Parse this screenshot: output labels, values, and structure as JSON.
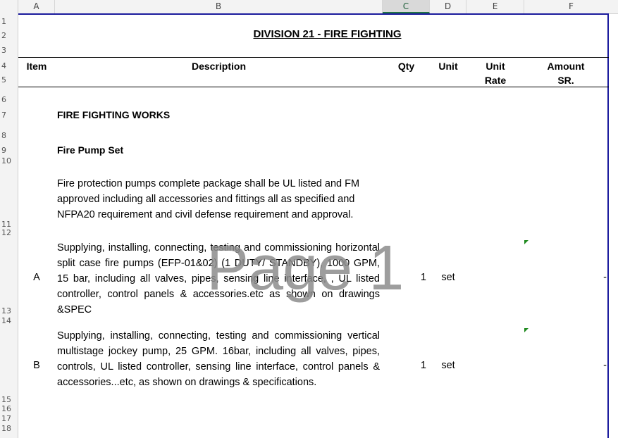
{
  "columns": [
    "A",
    "B",
    "C",
    "D",
    "E",
    "F"
  ],
  "selected_column": "C",
  "rows": [
    "1",
    "2",
    "3",
    "4",
    "5",
    "6",
    "7",
    "8",
    "9",
    "10",
    "11",
    "12",
    "13",
    "14",
    "15",
    "16",
    "17",
    "18"
  ],
  "title": "DIVISION 21 - FIRE FIGHTING",
  "header": {
    "item": "Item",
    "description": "Description",
    "qty": "Qty",
    "unit": "Unit",
    "unit_rate_line1": "Unit",
    "unit_rate_line2": "Rate",
    "amount_line1": "Amount",
    "amount_line2": "SR."
  },
  "section_title": "FIRE FIGHTING WORKS",
  "subsection_title": "Fire Pump Set",
  "intro_text": "Fire protection pumps complete package shall be UL listed and FM approved including all accessories and fittings all as specified and NFPA20 requirement and civil defense requirement and approval.",
  "items": [
    {
      "item": "A",
      "description": "Supplying, installing, connecting, testing and commissioning horizontal split case fire pumps (EFP-01&02) (1 DUTY/ STANDBY), 1000 GPM, 15 bar, including all valves, pipes, sensing line interface, , UL listed controller, control panels & accessories.etc as shown on drawings &SPEC",
      "qty": "1",
      "unit": "set",
      "amount": "-"
    },
    {
      "item": "B",
      "description": "Supplying, installing, connecting, testing and commissioning vertical multistage jockey pump, 25 GPM. 16bar, including all valves, pipes, controls, UL listed controller, sensing line interface, control panels & accessories...etc, as shown on drawings & specifications.",
      "qty": "1",
      "unit": "set",
      "amount": "-"
    }
  ],
  "watermark": "Page 1",
  "colors": {
    "page_border": "#1a1a9c",
    "comment_marker": "#1f8a1f",
    "selected_header": "#217346"
  }
}
